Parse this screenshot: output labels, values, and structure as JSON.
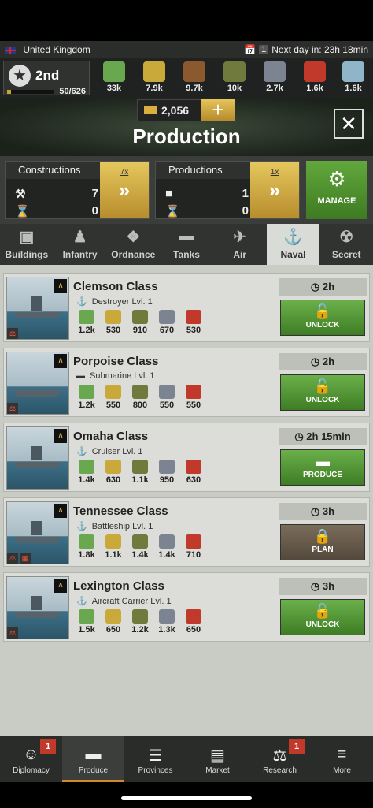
{
  "status": {
    "country": "United Kingdom",
    "day_count": "1",
    "next_day": "Next day in: 23h 18min"
  },
  "player": {
    "rank": "2nd",
    "xp": "50/626"
  },
  "resources": [
    {
      "name": "money",
      "value": "33k",
      "color": "#6aa84f"
    },
    {
      "name": "ammunition",
      "value": "7.9k",
      "color": "#c9a93a"
    },
    {
      "name": "supplies",
      "value": "9.7k",
      "color": "#8a5a2e"
    },
    {
      "name": "components",
      "value": "10k",
      "color": "#6f7a3c"
    },
    {
      "name": "steel",
      "value": "2.7k",
      "color": "#7d8491"
    },
    {
      "name": "fuel",
      "value": "1.6k",
      "color": "#c0392b"
    },
    {
      "name": "rare-materials",
      "value": "1.6k",
      "color": "#8fb5c9"
    }
  ],
  "header": {
    "gold": "2,056",
    "title": "Production"
  },
  "queues": {
    "constructions": {
      "label": "Constructions",
      "active": "7",
      "waiting": "0",
      "speed": "7x"
    },
    "productions": {
      "label": "Productions",
      "active": "1",
      "waiting": "0",
      "speed": "1x"
    },
    "manage_label": "MANAGE"
  },
  "tabs": [
    {
      "label": "Buildings",
      "icon": "factory-icon"
    },
    {
      "label": "Infantry",
      "icon": "soldier-icon"
    },
    {
      "label": "Ordnance",
      "icon": "cannon-icon"
    },
    {
      "label": "Tanks",
      "icon": "tank-icon"
    },
    {
      "label": "Air",
      "icon": "plane-icon"
    },
    {
      "label": "Naval",
      "icon": "ship-icon"
    },
    {
      "label": "Secret",
      "icon": "radiation-icon"
    }
  ],
  "units": [
    {
      "name": "Clemson Class",
      "type": "Destroyer Lvl. 1",
      "type_icon": "anchor-icon",
      "time": "2h",
      "action": "UNLOCK",
      "action_icon": "lock-icon",
      "costs": [
        "1.2k",
        "530",
        "910",
        "670",
        "530"
      ],
      "tags": [
        "flask-icon"
      ]
    },
    {
      "name": "Porpoise Class",
      "type": "Submarine Lvl. 1",
      "type_icon": "submarine-icon",
      "time": "2h",
      "action": "UNLOCK",
      "action_icon": "lock-icon",
      "costs": [
        "1.2k",
        "550",
        "800",
        "550",
        "550"
      ],
      "tags": [
        "flask-icon"
      ]
    },
    {
      "name": "Omaha Class",
      "type": "Cruiser Lvl. 1",
      "type_icon": "anchor-icon",
      "time": "2h 15min",
      "action": "PRODUCE",
      "action_icon": "tank-icon",
      "costs": [
        "1.4k",
        "630",
        "1.1k",
        "950",
        "630"
      ],
      "tags": []
    },
    {
      "name": "Tennessee Class",
      "type": "Battleship Lvl. 1",
      "type_icon": "anchor-icon",
      "time": "3h",
      "action": "PLAN",
      "action_icon": "lock-icon",
      "costs": [
        "1.8k",
        "1.1k",
        "1.4k",
        "1.4k",
        "710"
      ],
      "tags": [
        "flask-icon",
        "calendar-icon"
      ]
    },
    {
      "name": "Lexington Class",
      "type": "Aircraft Carrier Lvl. 1",
      "type_icon": "anchor-icon",
      "time": "3h",
      "action": "UNLOCK",
      "action_icon": "lock-icon",
      "costs": [
        "1.5k",
        "650",
        "1.2k",
        "1.3k",
        "650"
      ],
      "tags": [
        "flask-icon"
      ]
    }
  ],
  "nav": [
    {
      "label": "Diplomacy",
      "badge": "1"
    },
    {
      "label": "Produce",
      "badge": ""
    },
    {
      "label": "Provinces",
      "badge": ""
    },
    {
      "label": "Market",
      "badge": ""
    },
    {
      "label": "Research",
      "badge": "1"
    },
    {
      "label": "More",
      "badge": ""
    }
  ]
}
